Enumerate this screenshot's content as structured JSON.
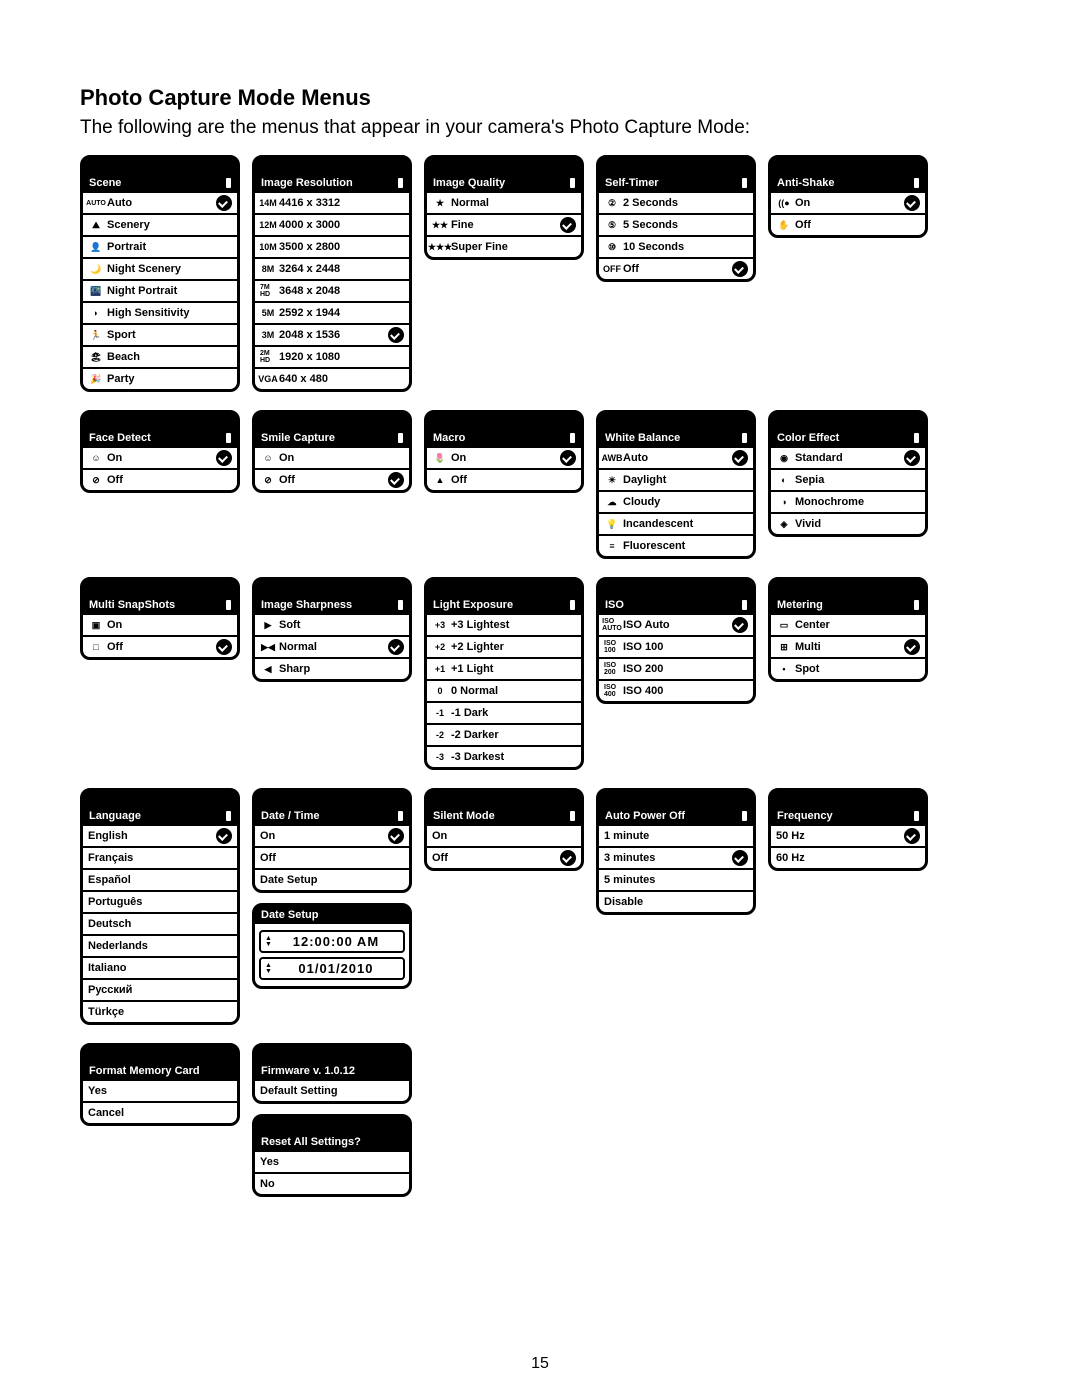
{
  "heading": "Photo Capture Mode Menus",
  "intro": "The following are the menus that appear in your camera's Photo Capture Mode:",
  "page_number": "15",
  "menus": {
    "scene": {
      "title": "Scene",
      "items": [
        {
          "icon": "AUTO",
          "label": "Auto",
          "checked": true
        },
        {
          "icon": "⛰",
          "label": "Scenery"
        },
        {
          "icon": "👤",
          "label": "Portrait"
        },
        {
          "icon": "🌙",
          "label": "Night Scenery"
        },
        {
          "icon": "🌃",
          "label": "Night Portrait"
        },
        {
          "icon": "◗",
          "label": "High Sensitivity"
        },
        {
          "icon": "🏃",
          "label": "Sport"
        },
        {
          "icon": "🏖",
          "label": "Beach"
        },
        {
          "icon": "🎉",
          "label": "Party"
        }
      ]
    },
    "resolution": {
      "title": "Image Resolution",
      "items": [
        {
          "icon": "14M",
          "label": "4416 x 3312"
        },
        {
          "icon": "12M",
          "label": "4000 x 3000"
        },
        {
          "icon": "10M",
          "label": "3500 x 2800"
        },
        {
          "icon": "8M",
          "label": "3264 x 2448"
        },
        {
          "icon": "7M HD",
          "label": "3648 x 2048"
        },
        {
          "icon": "5M",
          "label": "2592 x 1944"
        },
        {
          "icon": "3M",
          "label": "2048 x 1536",
          "checked": true
        },
        {
          "icon": "2M HD",
          "label": "1920 x 1080"
        },
        {
          "icon": "VGA",
          "label": "640 x 480"
        }
      ]
    },
    "quality": {
      "title": "Image Quality",
      "items": [
        {
          "icon": "★",
          "label": "Normal"
        },
        {
          "icon": "★★",
          "label": "Fine",
          "checked": true
        },
        {
          "icon": "★★★",
          "label": "Super Fine"
        }
      ]
    },
    "selftimer": {
      "title": "Self-Timer",
      "items": [
        {
          "icon": "②",
          "label": "2 Seconds"
        },
        {
          "icon": "⑤",
          "label": "5 Seconds"
        },
        {
          "icon": "⑩",
          "label": "10 Seconds"
        },
        {
          "icon": "OFF",
          "label": "Off",
          "checked": true
        }
      ]
    },
    "antishake": {
      "title": "Anti-Shake",
      "items": [
        {
          "icon": "((●",
          "label": "On",
          "checked": true
        },
        {
          "icon": "✋",
          "label": "Off"
        }
      ]
    },
    "facedetect": {
      "title": "Face Detect",
      "items": [
        {
          "icon": "☺",
          "label": "On",
          "checked": true
        },
        {
          "icon": "⊘",
          "label": "Off"
        }
      ]
    },
    "smile": {
      "title": "Smile Capture",
      "items": [
        {
          "icon": "☺",
          "label": "On"
        },
        {
          "icon": "⊘",
          "label": "Off",
          "checked": true
        }
      ]
    },
    "macro": {
      "title": "Macro",
      "items": [
        {
          "icon": "🌷",
          "label": "On",
          "checked": true
        },
        {
          "icon": "▲",
          "label": "Off"
        }
      ]
    },
    "wb": {
      "title": "White Balance",
      "items": [
        {
          "icon": "AWB",
          "label": "Auto",
          "checked": true
        },
        {
          "icon": "☀",
          "label": "Daylight"
        },
        {
          "icon": "☁",
          "label": "Cloudy"
        },
        {
          "icon": "💡",
          "label": "Incandescent"
        },
        {
          "icon": "≡",
          "label": "Fluorescent"
        }
      ]
    },
    "coloreffect": {
      "title": "Color Effect",
      "items": [
        {
          "icon": "◉",
          "label": "Standard",
          "checked": true
        },
        {
          "icon": "◐",
          "label": "Sepia"
        },
        {
          "icon": "◑",
          "label": "Monochrome"
        },
        {
          "icon": "◈",
          "label": "Vivid"
        }
      ]
    },
    "multisnap": {
      "title": "Multi SnapShots",
      "items": [
        {
          "icon": "▣",
          "label": "On"
        },
        {
          "icon": "□",
          "label": "Off",
          "checked": true
        }
      ]
    },
    "sharpness": {
      "title": "Image Sharpness",
      "items": [
        {
          "icon": "▶",
          "label": "Soft"
        },
        {
          "icon": "▶◀",
          "label": "Normal",
          "checked": true
        },
        {
          "icon": "◀",
          "label": "Sharp"
        }
      ]
    },
    "exposure": {
      "title": "Light Exposure",
      "items": [
        {
          "icon": "+3",
          "label": "+3 Lightest"
        },
        {
          "icon": "+2",
          "label": "+2 Lighter"
        },
        {
          "icon": "+1",
          "label": "+1 Light"
        },
        {
          "icon": "0",
          "label": "0 Normal"
        },
        {
          "icon": "-1",
          "label": "-1 Dark"
        },
        {
          "icon": "-2",
          "label": "-2 Darker"
        },
        {
          "icon": "-3",
          "label": "-3 Darkest"
        }
      ]
    },
    "iso": {
      "title": "ISO",
      "items": [
        {
          "icon": "ISO AUTO",
          "label": "ISO Auto",
          "checked": true
        },
        {
          "icon": "ISO 100",
          "label": "ISO 100"
        },
        {
          "icon": "ISO 200",
          "label": "ISO 200"
        },
        {
          "icon": "ISO 400",
          "label": "ISO 400"
        }
      ]
    },
    "metering": {
      "title": "Metering",
      "items": [
        {
          "icon": "▭",
          "label": "Center"
        },
        {
          "icon": "⊞",
          "label": "Multi",
          "checked": true
        },
        {
          "icon": "•",
          "label": "Spot"
        }
      ]
    },
    "language": {
      "title": "Language",
      "items": [
        {
          "label": "English",
          "checked": true
        },
        {
          "label": "Français"
        },
        {
          "label": "Español"
        },
        {
          "label": "Português"
        },
        {
          "label": "Deutsch"
        },
        {
          "label": "Nederlands"
        },
        {
          "label": "Italiano"
        },
        {
          "label": "Русский"
        },
        {
          "label": "Türkçe"
        }
      ]
    },
    "datetime_menu": {
      "title": "Date / Time",
      "items": [
        {
          "label": "On",
          "checked": true
        },
        {
          "label": "Off"
        },
        {
          "label": "Date Setup"
        }
      ]
    },
    "datesetup": {
      "title": "Date Setup",
      "time": "12:00:00 AM",
      "date": "01/01/2010"
    },
    "silent": {
      "title": "Silent Mode",
      "items": [
        {
          "label": "On"
        },
        {
          "label": "Off",
          "checked": true
        }
      ]
    },
    "autopower": {
      "title": "Auto Power Off",
      "items": [
        {
          "label": "1 minute"
        },
        {
          "label": "3 minutes",
          "checked": true
        },
        {
          "label": "5 minutes"
        },
        {
          "label": "Disable"
        }
      ]
    },
    "frequency": {
      "title": "Frequency",
      "items": [
        {
          "label": "50 Hz",
          "checked": true
        },
        {
          "label": "60 Hz"
        }
      ]
    },
    "format": {
      "title": "Format Memory Card",
      "items": [
        {
          "label": "Yes"
        },
        {
          "label": "Cancel"
        }
      ]
    },
    "firmware": {
      "title": "Firmware v. 1.0.12",
      "items": [
        {
          "label": "Default Setting",
          "centered": true
        }
      ]
    },
    "reset": {
      "title": "Reset All Settings?",
      "items": [
        {
          "label": "Yes"
        },
        {
          "label": "No"
        }
      ]
    }
  }
}
